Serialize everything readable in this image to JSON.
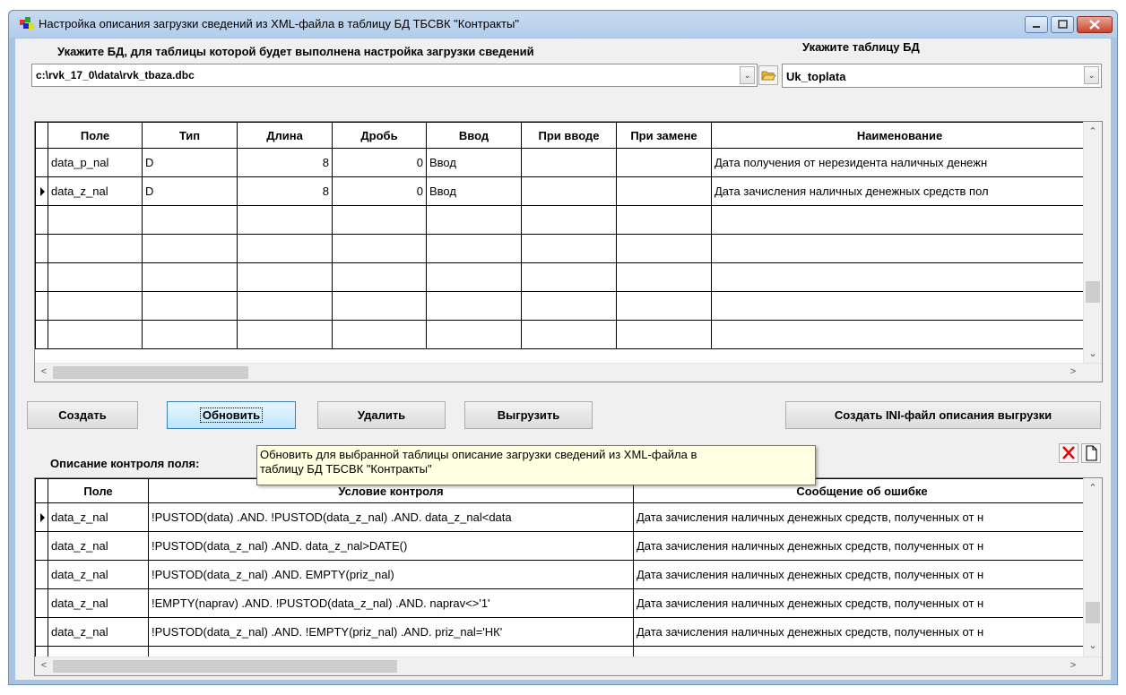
{
  "window": {
    "title": "Настройка описания загрузки сведений из XML-файла в таблицу БД ТБСВК \"Контракты\""
  },
  "db_section": {
    "label": "Укажите БД, для таблицы которой будет выполнена настройка загрузки сведений",
    "path_value": "c:\\rvk_17_0\\data\\rvk_tbaza.dbc"
  },
  "table_section": {
    "label": "Укажите таблицу БД",
    "selected": "Uk_toplata"
  },
  "fields_grid": {
    "columns": [
      "Поле",
      "Тип",
      "Длина",
      "Дробь",
      "Ввод",
      "При вводе",
      "При замене",
      "Наименование"
    ],
    "rows": [
      {
        "pole": "data_p_nal",
        "tip": "D",
        "dlina": "8",
        "drob": "0",
        "vvod": "Ввод",
        "pri_vvode": "",
        "pri_zamene": "",
        "naim": "Дата получения от нерезидента наличных денежн"
      },
      {
        "pole": "data_z_nal",
        "tip": "D",
        "dlina": "8",
        "drob": "0",
        "vvod": "Ввод",
        "pri_vvode": "",
        "pri_zamene": "",
        "naim": "Дата зачисления наличных денежных средств пол"
      }
    ]
  },
  "buttons": {
    "create": "Создать",
    "update": "Обновить",
    "delete": "Удалить",
    "export": "Выгрузить",
    "create_ini": "Создать INI-файл описания выгрузки"
  },
  "tooltip": {
    "line1": "Обновить для выбранной таблицы описание загрузки сведений из XML-файла в",
    "line2": "таблицу БД ТБСВК \"Контракты\""
  },
  "control_section": {
    "label": "Описание контроля поля:",
    "columns": [
      "Поле",
      "Условие контроля",
      "Сообщение об ошибке"
    ],
    "rows": [
      {
        "pole": "data_z_nal",
        "cond": "!PUSTOD(data) .AND. !PUSTOD(data_z_nal) .AND. data_z_nal<data",
        "msg": "Дата зачисления наличных денежных средств, полученных от н"
      },
      {
        "pole": "data_z_nal",
        "cond": "!PUSTOD(data_z_nal) .AND. data_z_nal>DATE()",
        "msg": "Дата зачисления наличных денежных средств, полученных от н"
      },
      {
        "pole": "data_z_nal",
        "cond": "!PUSTOD(data_z_nal) .AND. EMPTY(priz_nal)",
        "msg": "Дата зачисления наличных денежных средств, полученных от н"
      },
      {
        "pole": "data_z_nal",
        "cond": "!EMPTY(naprav) .AND. !PUSTOD(data_z_nal) .AND. naprav<>'1'",
        "msg": "Дата зачисления наличных денежных средств, полученных от н"
      },
      {
        "pole": "data_z_nal",
        "cond": "!PUSTOD(data_z_nal) .AND. !EMPTY(priz_nal) .AND. priz_nal='НК'",
        "msg": "Дата зачисления наличных денежных средств, полученных от н"
      }
    ]
  },
  "icons": [
    "app-icon",
    "minimize-icon",
    "maximize-icon",
    "close-icon",
    "dropdown-arrow-icon",
    "folder-open-icon",
    "row-pointer-icon",
    "delete-x-icon",
    "new-document-icon"
  ],
  "colors": {
    "delete_icon": "#e00000",
    "tooltip_bg": "#ffffe1",
    "titlebar": "#b2cdea",
    "close_button": "#c9442c"
  }
}
